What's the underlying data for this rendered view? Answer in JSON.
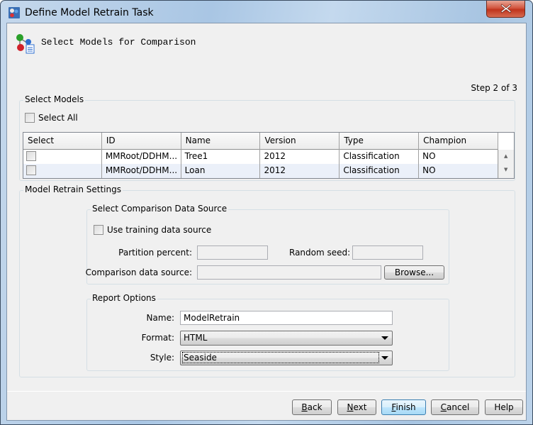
{
  "window": {
    "title": "Define Model Retrain Task",
    "close_icon": "close-x-icon"
  },
  "header": {
    "icon": "model-comparison-icon",
    "title": "Select Models for Comparison",
    "step": "Step 2 of 3"
  },
  "select_models": {
    "group_label": "Select Models",
    "select_all_label": "Select All",
    "select_all_checked": false,
    "columns": [
      "Select",
      "ID",
      "Name",
      "Version",
      "Type",
      "Champion"
    ],
    "rows": [
      {
        "checked": false,
        "id": "MMRoot/DDHM...",
        "name": "Tree1",
        "version": "2012",
        "type": "Classification",
        "champion": "NO"
      },
      {
        "checked": false,
        "id": "MMRoot/DDHM...",
        "name": "Loan",
        "version": "2012",
        "type": "Classification",
        "champion": "NO"
      }
    ]
  },
  "retrain_settings": {
    "group_label": "Model Retrain Settings",
    "comparison": {
      "group_label": "Select Comparison Data Source",
      "use_training_label": "Use training data source",
      "use_training_checked": false,
      "partition_label": "Partition percent:",
      "partition_value": "",
      "seed_label": "Random seed:",
      "seed_value": "",
      "source_label": "Comparison data source:",
      "source_value": "",
      "browse_label": "Browse..."
    },
    "report": {
      "group_label": "Report Options",
      "name_label": "Name:",
      "name_value": "ModelRetrain",
      "format_label": "Format:",
      "format_value": "HTML",
      "style_label": "Style:",
      "style_value": "Seaside"
    }
  },
  "footer": {
    "back": {
      "accel": "B",
      "rest": "ack"
    },
    "next": {
      "accel": "N",
      "rest": "ext"
    },
    "finish": {
      "accel": "F",
      "rest": "inish"
    },
    "cancel": {
      "accel": "C",
      "rest": "ancel"
    },
    "help": "Help"
  }
}
